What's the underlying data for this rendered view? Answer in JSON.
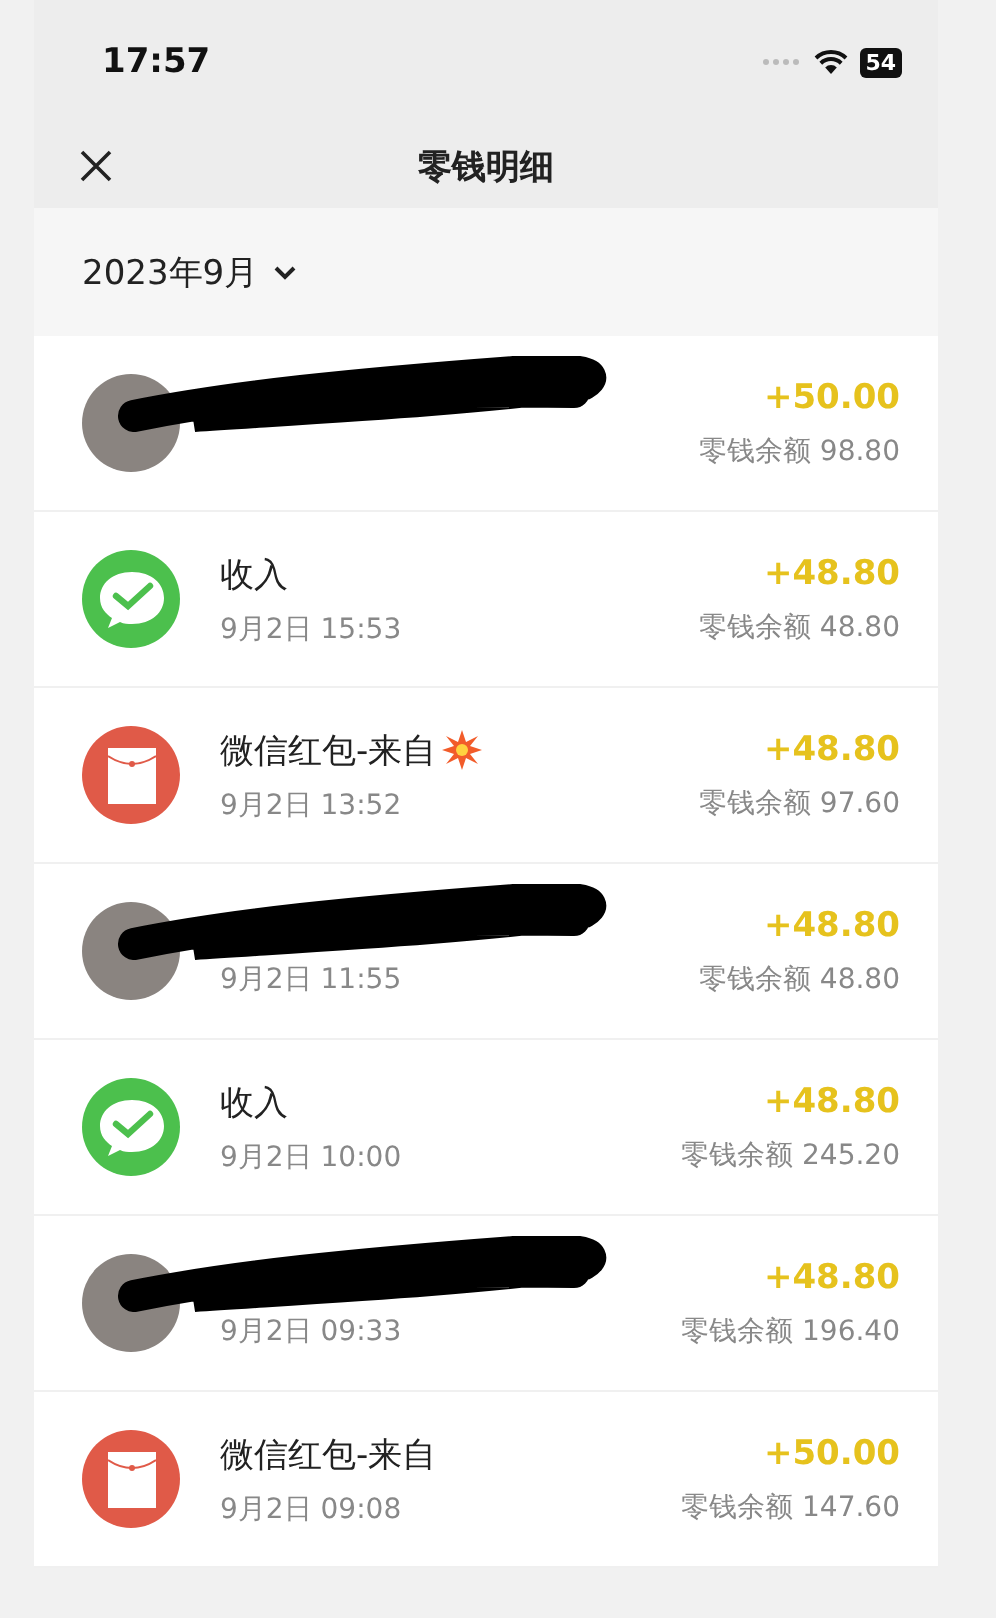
{
  "status_bar": {
    "time": "17:57",
    "battery": "54"
  },
  "nav": {
    "title": "零钱明细"
  },
  "month": {
    "label": "2023年9月"
  },
  "transactions": [
    {
      "kind": "avatar",
      "redacted": true,
      "amount": "+50.00",
      "balance": "零钱余额 98.80",
      "burst": false
    },
    {
      "kind": "wechat",
      "redacted": false,
      "title": "收入",
      "time": "9月2日 15:53",
      "amount": "+48.80",
      "balance": "零钱余额 48.80",
      "burst": false
    },
    {
      "kind": "redpacket",
      "redacted": false,
      "title": "微信红包-来自",
      "time": "9月2日 13:52",
      "amount": "+48.80",
      "balance": "零钱余额 97.60",
      "burst": true
    },
    {
      "kind": "avatar",
      "redacted": true,
      "time": "9月2日 11:55",
      "amount": "+48.80",
      "balance": "零钱余额 48.80",
      "burst": false
    },
    {
      "kind": "wechat",
      "redacted": false,
      "title": "收入",
      "time": "9月2日 10:00",
      "amount": "+48.80",
      "balance": "零钱余额 245.20",
      "burst": false
    },
    {
      "kind": "avatar",
      "redacted": true,
      "time": "9月2日 09:33",
      "amount": "+48.80",
      "balance": "零钱余额 196.40",
      "burst": false
    },
    {
      "kind": "redpacket",
      "redacted": false,
      "title": "微信红包-来自",
      "time": "9月2日 09:08",
      "amount": "+50.00",
      "balance": "零钱余额 147.60",
      "burst": false
    }
  ]
}
